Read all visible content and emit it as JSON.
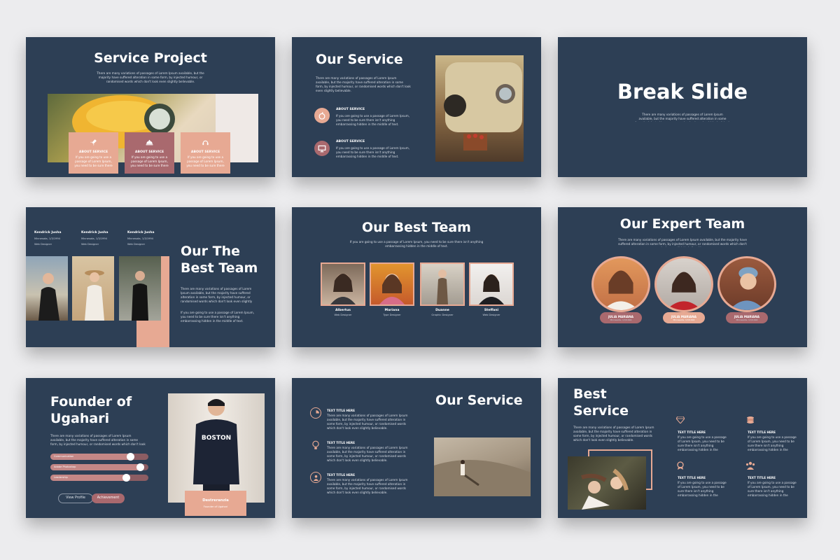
{
  "lorem_long": "There are many variations of passages of Lorem Ipsum available, but the majority have suffered alteration in some form, by injected humour, or randomised words which don't look even slightly believable.",
  "lorem_short": "If you are going to use a passage of Lorem Ipsum, you need to be sure there isn't anything embarrassing hidden in the middle of text.",
  "slide1": {
    "title": "Service Project",
    "cards": [
      {
        "label": "ABOUT SERVICE",
        "icon": "rocket-icon"
      },
      {
        "label": "ABOUT SERVICE",
        "icon": "cloche-icon"
      },
      {
        "label": "ABOUT SERVICE",
        "icon": "headset-icon"
      }
    ]
  },
  "slide2": {
    "title": "Our Service",
    "items": [
      {
        "label": "ABOUT SERVICE",
        "icon": "fruit-icon"
      },
      {
        "label": "ABOUT SERVICE",
        "icon": "presentation-icon"
      }
    ]
  },
  "slide3": {
    "title": "Break Slide"
  },
  "slide4": {
    "title_line1": "Our The",
    "title_line2": "Best Team",
    "people": [
      {
        "name": "Kendrick Jusha",
        "sub": "Minnesota, 1/3/1994",
        "role": "Web Designer"
      },
      {
        "name": "Kendrick Jusha",
        "sub": "Minnesota, 1/3/1994",
        "role": "Web Designer"
      },
      {
        "name": "Kendrick Jusha",
        "sub": "Minnesota, 1/3/1994",
        "role": "Web Designer"
      }
    ]
  },
  "slide5": {
    "title": "Our Best Team",
    "members": [
      {
        "name": "Albertus",
        "role": "Web Designer"
      },
      {
        "name": "Mariana",
        "role": "Type Designer"
      },
      {
        "name": "Duanne",
        "role": "Graphic Designer"
      },
      {
        "name": "Steffani",
        "role": "Web Designer"
      }
    ]
  },
  "slide6": {
    "title": "Our Expert Team",
    "members": [
      {
        "name": "JULIA MARIANA",
        "role": "Minnesota, 1/3/1994"
      },
      {
        "name": "JULIA MARIANA",
        "role": "Minnesota, 1/3/1994"
      },
      {
        "name": "JULIA MARIANA",
        "role": "Minnesota, 1/3/1994"
      }
    ]
  },
  "slide7": {
    "title_line1": "Founder of",
    "title_line2": "Ugahari",
    "sliders": [
      {
        "label": "Communication",
        "level": 0.82
      },
      {
        "label": "Adobe Photoshop",
        "level": 0.92
      },
      {
        "label": "Leadership",
        "level": 0.78
      }
    ],
    "btn_view": "View Profile",
    "btn_achievement": "Achievement",
    "name": "Destreranzia",
    "role": "Founder of Ugahari"
  },
  "slide8": {
    "title": "Our Service",
    "items": [
      {
        "label": "TEXT TITLE HERE",
        "icon": "chart-icon"
      },
      {
        "label": "TEXT TITLE HERE",
        "icon": "bulb-icon"
      },
      {
        "label": "TEXT TITLE HERE",
        "icon": "people-icon"
      }
    ]
  },
  "slide9": {
    "title_line1": "Best",
    "title_line2": "Service",
    "items": [
      {
        "label": "TEXT TITLE HERE",
        "icon": "diamond-icon"
      },
      {
        "label": "TEXT TITLE HERE",
        "icon": "coins-icon"
      },
      {
        "label": "TEXT TITLE HERE",
        "icon": "award-icon"
      },
      {
        "label": "TEXT TITLE HERE",
        "icon": "team-icon"
      }
    ]
  },
  "colors": {
    "slide_bg": "#2d3f55",
    "accent_pink": "#e7a993",
    "accent_mauve": "#a9696e",
    "page_bg": "#ececee"
  }
}
